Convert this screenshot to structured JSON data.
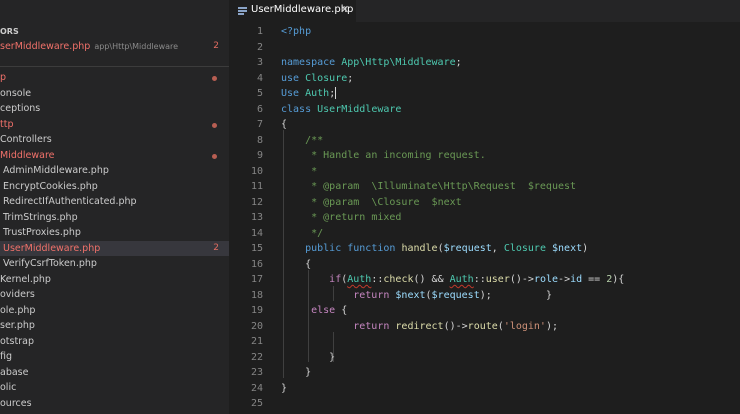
{
  "sidebar": {
    "open_editors_header": "ORS",
    "open_editor": {
      "name": "serMiddleware.php",
      "path": "app\\Http\\Middleware",
      "badge": "2"
    },
    "tree": [
      {
        "label": "p",
        "status": "dot"
      },
      {
        "label": "onsole"
      },
      {
        "label": "ceptions"
      },
      {
        "label": "ttp",
        "status": "dot"
      },
      {
        "label": "Controllers"
      },
      {
        "label": "Middleware",
        "status": "dot"
      },
      {
        "label": "AdminMiddleware.php"
      },
      {
        "label": "EncryptCookies.php"
      },
      {
        "label": "RedirectIfAuthenticated.php"
      },
      {
        "label": "TrimStrings.php"
      },
      {
        "label": "TrustProxies.php"
      },
      {
        "label": "UserMiddleware.php",
        "badge": "2"
      },
      {
        "label": "VerifyCsrfToken.php"
      },
      {
        "label": "Kernel.php"
      },
      {
        "label": "oviders"
      },
      {
        "label": "ole.php"
      },
      {
        "label": "ser.php"
      },
      {
        "label": "otstrap"
      },
      {
        "label": "fig"
      },
      {
        "label": "abase"
      },
      {
        "label": "olic"
      },
      {
        "label": "ources"
      }
    ]
  },
  "tab": {
    "label": "UserMiddleware.php",
    "close_glyph": "✕"
  },
  "line_numbers": [
    "1",
    "2",
    "3",
    "4",
    "5",
    "6",
    "7",
    "8",
    "9",
    "10",
    "11",
    "12",
    "13",
    "14",
    "15",
    "16",
    "17",
    "18",
    "19",
    "20",
    "21",
    "22",
    "23",
    "24",
    "25"
  ],
  "code": {
    "php_open": "<?php",
    "namespace_kw": "namespace",
    "namespace_name": "App\\Http\\Middleware",
    "use_kw": "use",
    "closure": "Closure",
    "use2_kw": "Use",
    "auth": "Auth",
    "class_kw": "class",
    "class_name": "UserMiddleware",
    "doc_open": "/**",
    "doc_desc": " * Handle an incoming request.",
    "doc_star": " *",
    "doc_param1_tag": " * @param",
    "doc_param1_type": "\\Illuminate\\Http\\Request",
    "doc_param1_var": "$request",
    "doc_param2_tag": " * @param",
    "doc_param2_type": "\\Closure",
    "doc_param2_var": "$next",
    "doc_return_tag": " * @return",
    "doc_return_type": "mixed",
    "doc_close": " */",
    "public_kw": "public",
    "function_kw": "function",
    "method_name": "handle",
    "param_request": "$request",
    "param_closure": "Closure",
    "param_next": "$next",
    "if_kw": "if",
    "check_fn": "check",
    "user_fn": "user",
    "role_prop": "role",
    "id_prop": "id",
    "two": "2",
    "return_kw": "return",
    "next_var": "$next",
    "request_var": "$request",
    "else_kw": "else",
    "redirect_fn": "redirect",
    "route_fn": "route",
    "login_str": "'login'"
  }
}
